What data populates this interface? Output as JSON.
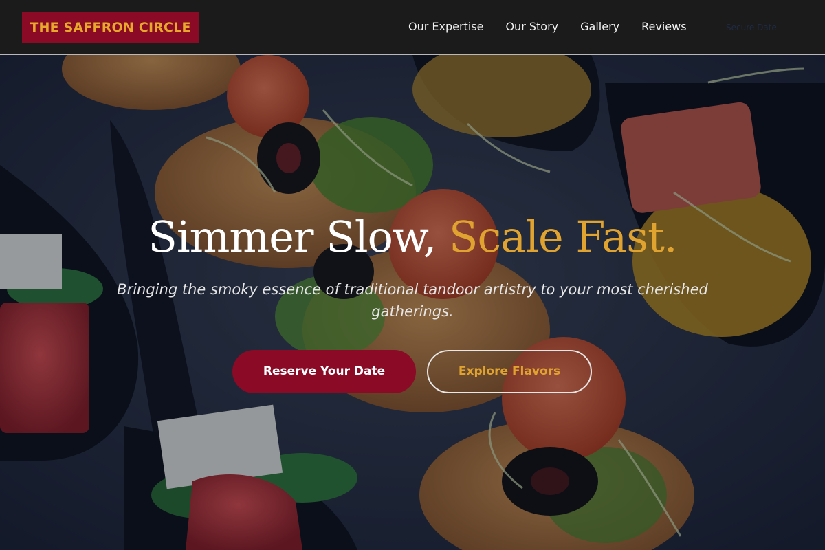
{
  "brand": {
    "name": "THE SAFFRON CIRCLE"
  },
  "nav": {
    "items": [
      {
        "label": "Our Expertise"
      },
      {
        "label": "Our Story"
      },
      {
        "label": "Gallery"
      },
      {
        "label": "Reviews"
      }
    ],
    "cta_label": "Secure Date"
  },
  "hero": {
    "headline_part1": "Simmer Slow, ",
    "headline_accent": "Scale Fast.",
    "subtitle": "Bringing the smoky essence of traditional tandoor artistry to your most cherished gatherings.",
    "primary_button": "Reserve Your Date",
    "secondary_button": "Explore Flavors",
    "background_description_icon": "food-photo"
  },
  "colors": {
    "brand_red": "#8b0a26",
    "accent_gold": "#e0a330",
    "nav_bg": "#1b1b1b"
  }
}
